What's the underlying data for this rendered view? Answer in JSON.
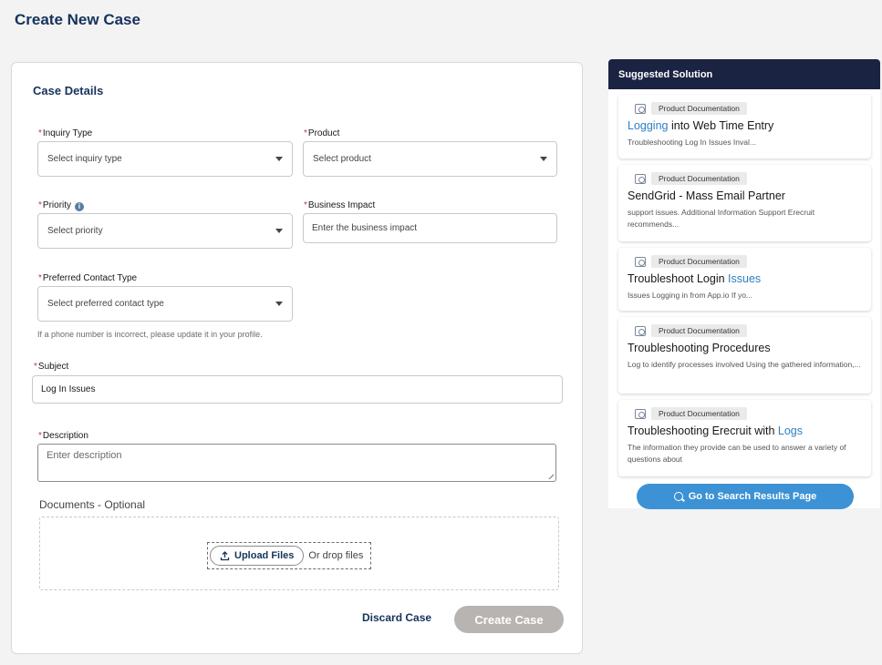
{
  "page": {
    "title": "Create New Case"
  },
  "form": {
    "section_title": "Case Details",
    "required_marker": "*",
    "inquiry_type": {
      "label": "Inquiry Type",
      "placeholder": "Select inquiry type"
    },
    "product": {
      "label": "Product",
      "placeholder": "Select product"
    },
    "priority": {
      "label": "Priority",
      "placeholder": "Select priority"
    },
    "business_impact": {
      "label": "Business Impact",
      "placeholder": "Enter the business impact"
    },
    "preferred_contact": {
      "label": "Preferred Contact Type",
      "placeholder": "Select preferred contact type"
    },
    "helper_text": "If a phone number is incorrect, please update it in your profile.",
    "subject": {
      "label": "Subject",
      "value": "Log In Issues"
    },
    "description": {
      "label": "Description",
      "placeholder": "Enter description"
    },
    "documents": {
      "label": "Documents - Optional",
      "upload_label": "Upload Files",
      "drop_label": "Or drop files"
    },
    "actions": {
      "discard_label": "Discard Case",
      "create_label": "Create Case"
    }
  },
  "suggestions": {
    "header": "Suggested Solution",
    "items": [
      {
        "tag": "Product Documentation",
        "title_pre": "",
        "title_hl": "Logging",
        "title_post": " into Web Time Entry",
        "desc": "Troubleshooting Log In Issues Inval..."
      },
      {
        "tag": "Product Documentation",
        "title_pre": "SendGrid - Mass Email Partner",
        "title_hl": "",
        "title_post": "",
        "desc": "support issues. Additional Information Support Erecruit recommends..."
      },
      {
        "tag": "Product Documentation",
        "title_pre": "Troubleshoot Login ",
        "title_hl": "Issues",
        "title_post": "",
        "desc": "Issues Logging in from App.io If yo..."
      },
      {
        "tag": "Product Documentation",
        "title_pre": "Troubleshooting Procedures",
        "title_hl": "",
        "title_post": "",
        "desc": "Log to identify processes involved Using the gathered information,..."
      },
      {
        "tag": "Product Documentation",
        "title_pre": "Troubleshooting Erecruit with ",
        "title_hl": "Logs",
        "title_post": "",
        "desc": "The information they provide can be used to answer a variety of questions about"
      }
    ],
    "go_button": "Go to Search Results Page"
  },
  "icons": {
    "info": "info-icon",
    "dropdown": "chevron-down-icon",
    "upload": "upload-icon",
    "document": "document-icon",
    "search": "search-icon"
  },
  "colors": {
    "brand_navy": "#16325c",
    "panel_header": "#1b2343",
    "accent_blue": "#3c92d4",
    "required_red": "#c23934",
    "disabled_button": "#b8b4b1"
  }
}
